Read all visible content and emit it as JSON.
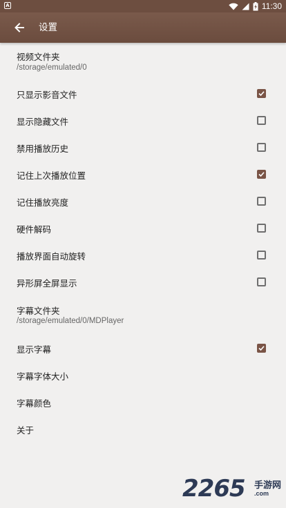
{
  "status_bar": {
    "time": "11:30",
    "app_icon": "A",
    "icons": [
      "wifi-icon",
      "signal-icon",
      "battery-charging-icon"
    ]
  },
  "app_bar": {
    "title": "设置",
    "back_icon": "arrow-left-icon"
  },
  "colors": {
    "app_bar": "#6d4e40",
    "accent": "#7a5446",
    "background": "#f1f0ef"
  },
  "settings": {
    "video_folder": {
      "label": "视频文件夹",
      "value": "/storage/emulated/0"
    },
    "show_media_only": {
      "label": "只显示影音文件",
      "checked": true
    },
    "show_hidden": {
      "label": "显示隐藏文件",
      "checked": false
    },
    "disable_history": {
      "label": "禁用播放历史",
      "checked": false
    },
    "remember_position": {
      "label": "记住上次播放位置",
      "checked": true
    },
    "remember_brightness": {
      "label": "记住播放亮度",
      "checked": false
    },
    "hardware_decode": {
      "label": "硬件解码",
      "checked": false
    },
    "auto_rotate": {
      "label": "播放界面自动旋转",
      "checked": false
    },
    "notch_fullscreen": {
      "label": "异形屏全屏显示",
      "checked": false
    },
    "subtitle_folder": {
      "label": "字幕文件夹",
      "value": "/storage/emulated/0/MDPlayer"
    },
    "show_subtitle": {
      "label": "显示字幕",
      "checked": true
    },
    "subtitle_font_size": {
      "label": "字幕字体大小"
    },
    "subtitle_color": {
      "label": "字幕颜色"
    },
    "about": {
      "label": "关于"
    }
  },
  "watermark": {
    "number": "2265",
    "site_name": "手游网",
    "domain": ".com"
  }
}
